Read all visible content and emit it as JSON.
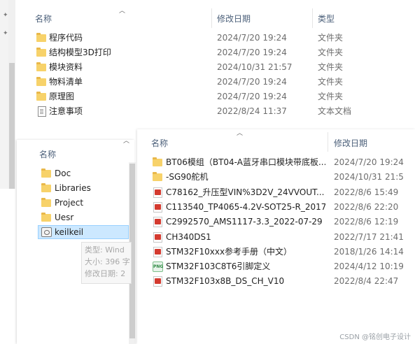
{
  "top_window": {
    "columns": {
      "name": "名称",
      "date": "修改日期",
      "type": "类型"
    },
    "rows": [
      {
        "name": "程序代码",
        "date": "2024/7/20 19:24",
        "type": "文件夹",
        "icon": "folder-icon"
      },
      {
        "name": "结构模型3D打印",
        "date": "2024/7/20 19:24",
        "type": "文件夹",
        "icon": "folder-icon"
      },
      {
        "name": "模块资料",
        "date": "2024/10/31 21:57",
        "type": "文件夹",
        "icon": "folder-icon"
      },
      {
        "name": "物料清单",
        "date": "2024/7/20 19:24",
        "type": "文件夹",
        "icon": "folder-icon"
      },
      {
        "name": "原理图",
        "date": "2024/7/20 19:24",
        "type": "文件夹",
        "icon": "folder-icon"
      },
      {
        "name": "注意事项",
        "date": "2022/8/24 11:37",
        "type": "文本文档",
        "icon": "text-document-icon"
      }
    ]
  },
  "left_window": {
    "column_name": "名称",
    "items": [
      {
        "name": "Doc",
        "icon": "folder-icon"
      },
      {
        "name": "Libraries",
        "icon": "folder-icon"
      },
      {
        "name": "Project",
        "icon": "folder-icon"
      },
      {
        "name": "Uesr",
        "icon": "folder-icon"
      },
      {
        "name": "keilkeil",
        "icon": "keil-project-icon"
      }
    ],
    "tooltip": {
      "line1": "类型: Wind",
      "line2": "大小: 396 字",
      "line3": "修改日期: 2"
    }
  },
  "right_window": {
    "columns": {
      "name": "名称",
      "date": "修改日期"
    },
    "rows": [
      {
        "name": "BT06模组（BT04-A蓝牙串口模块带底板...",
        "date": "2024/7/20 19:24",
        "icon": "folder-icon"
      },
      {
        "name": "-SG90舵机",
        "date": "2024/10/31 21:5",
        "icon": "folder-icon"
      },
      {
        "name": "C78162_升压型VIN%3D2V_24VVOUT...",
        "date": "2022/8/6 15:49",
        "icon": "pdf-icon"
      },
      {
        "name": "C113540_TP4065-4.2V-SOT25-R_2017...",
        "date": "2022/8/6 22:20",
        "icon": "pdf-icon"
      },
      {
        "name": "C2992570_AMS1117-3.3_2022-07-29",
        "date": "2022/8/6 12:19",
        "icon": "pdf-icon"
      },
      {
        "name": "CH340DS1",
        "date": "2022/7/17 21:41",
        "icon": "pdf-icon"
      },
      {
        "name": "STM32F10xxx参考手册（中文）",
        "date": "2018/1/26 14:14",
        "icon": "pdf-icon"
      },
      {
        "name": "STM32F103C8T6引脚定义",
        "date": "2024/4/12 10:19",
        "icon": "png-icon"
      },
      {
        "name": "STM32F103x8B_DS_CH_V10",
        "date": "2022/8/4 22:47",
        "icon": "pdf-icon"
      }
    ]
  },
  "watermark": "CSDN @铭创电子设计",
  "colors": {
    "folder": "#f7d26a",
    "header_text": "#4c607a",
    "selected_bg": "#cce8ff",
    "pdf_red": "#d43a2f"
  }
}
